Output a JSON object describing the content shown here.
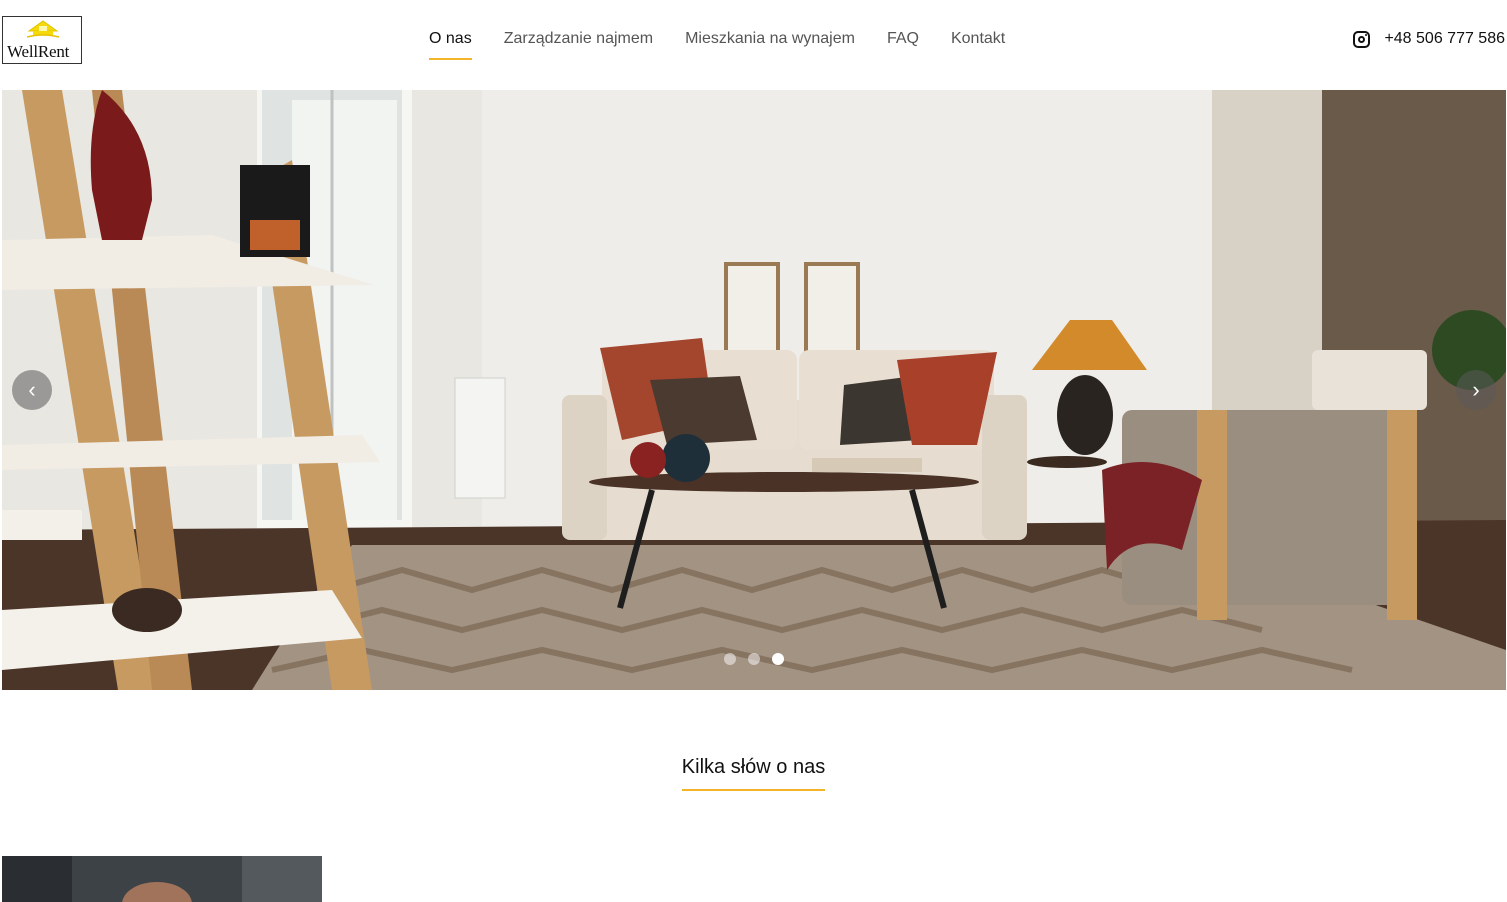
{
  "brand": {
    "logo_text": "WellRent",
    "logo_icon": "house-roof-icon",
    "accent": "#f3b42a"
  },
  "nav": {
    "items": [
      {
        "label": "O nas",
        "active": true
      },
      {
        "label": "Zarządzanie najmem",
        "active": false
      },
      {
        "label": "Mieszkania na wynajem",
        "active": false
      },
      {
        "label": "FAQ",
        "active": false
      },
      {
        "label": "Kontakt",
        "active": false
      }
    ]
  },
  "contact": {
    "icon": "instagram-icon",
    "phone": "+48 506 777 586"
  },
  "hero": {
    "image": "living-room-interior-photo",
    "prev_icon": "chevron-left-icon",
    "next_icon": "chevron-right-icon",
    "prev_symbol": "‹",
    "next_symbol": "›",
    "slide_count": 3,
    "active_slide": 3
  },
  "about": {
    "title": "Kilka słów o nas",
    "image": "person-portrait-photo"
  }
}
